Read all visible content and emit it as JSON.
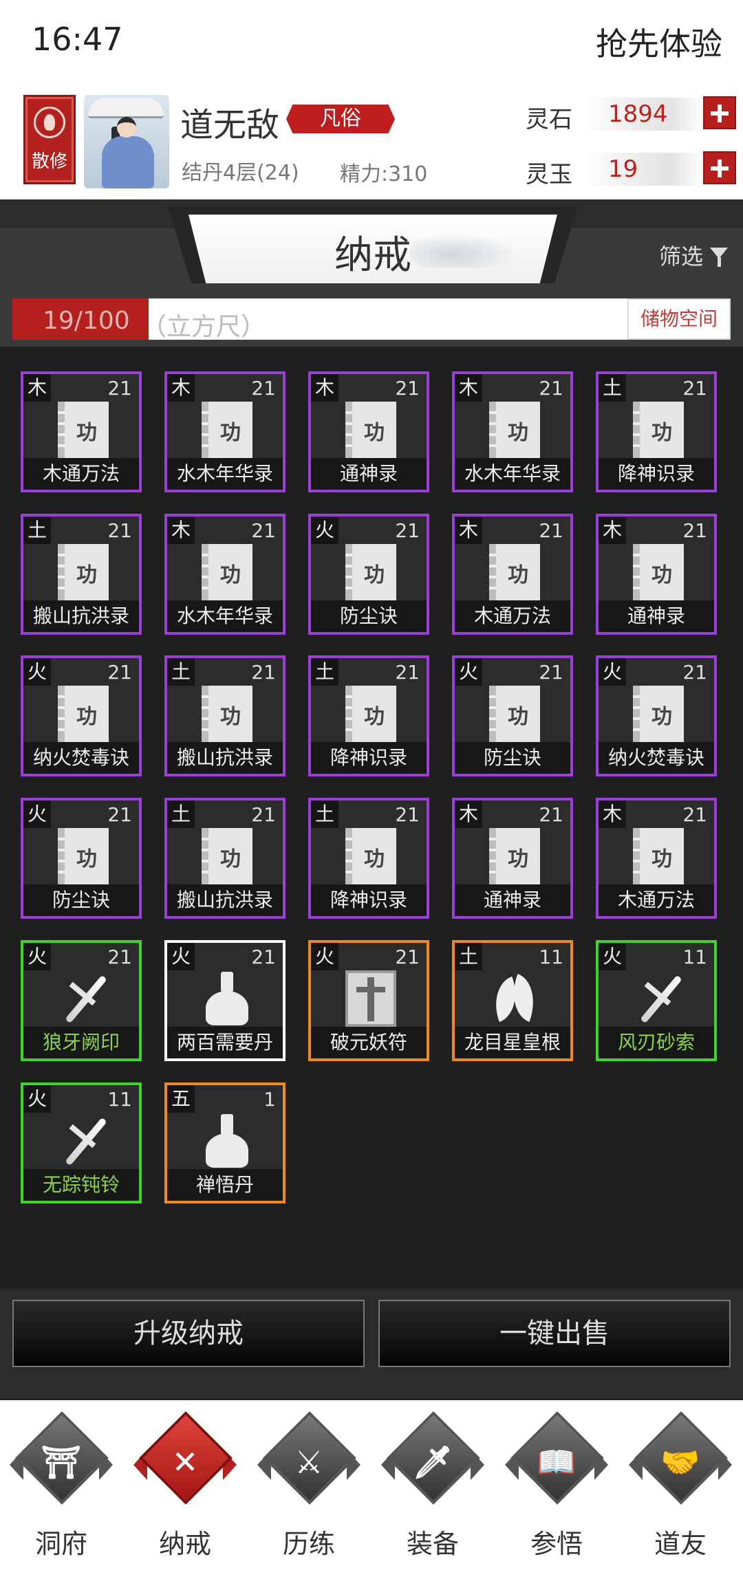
{
  "status": {
    "time": "16:47",
    "trial": "抢先体验"
  },
  "player": {
    "sect": "散修",
    "name": "道无敌",
    "realm_tag": "凡俗",
    "cultivation": "结丹4层(24)",
    "energy": "精力:310"
  },
  "resources": [
    {
      "label": "灵石",
      "value": "1894"
    },
    {
      "label": "灵玉",
      "value": "19"
    }
  ],
  "storage": {
    "title": "纳戒",
    "filter": "筛选",
    "capacity": "19/100",
    "unit": "（立方尺）",
    "space_button": "储物空间",
    "capacity_fraction": 0.19
  },
  "items": [
    {
      "element": "木",
      "level": "21",
      "name": "木通万法",
      "icon": "book-icon",
      "rarity_color": "#9c3fd8"
    },
    {
      "element": "木",
      "level": "21",
      "name": "水木年华录",
      "icon": "book-icon",
      "rarity_color": "#9c3fd8"
    },
    {
      "element": "木",
      "level": "21",
      "name": "通神录",
      "icon": "book-icon",
      "rarity_color": "#9c3fd8"
    },
    {
      "element": "木",
      "level": "21",
      "name": "水木年华录",
      "icon": "book-icon",
      "rarity_color": "#9c3fd8"
    },
    {
      "element": "土",
      "level": "21",
      "name": "降神识录",
      "icon": "book-icon",
      "rarity_color": "#9c3fd8"
    },
    {
      "element": "土",
      "level": "21",
      "name": "搬山抗洪录",
      "icon": "book-icon",
      "rarity_color": "#9c3fd8"
    },
    {
      "element": "木",
      "level": "21",
      "name": "水木年华录",
      "icon": "book-icon",
      "rarity_color": "#9c3fd8"
    },
    {
      "element": "火",
      "level": "21",
      "name": "防尘诀",
      "icon": "book-icon",
      "rarity_color": "#9c3fd8"
    },
    {
      "element": "木",
      "level": "21",
      "name": "木通万法",
      "icon": "book-icon",
      "rarity_color": "#9c3fd8"
    },
    {
      "element": "木",
      "level": "21",
      "name": "通神录",
      "icon": "book-icon",
      "rarity_color": "#9c3fd8"
    },
    {
      "element": "火",
      "level": "21",
      "name": "纳火焚毒诀",
      "icon": "book-icon",
      "rarity_color": "#9c3fd8"
    },
    {
      "element": "土",
      "level": "21",
      "name": "搬山抗洪录",
      "icon": "book-icon",
      "rarity_color": "#9c3fd8"
    },
    {
      "element": "土",
      "level": "21",
      "name": "降神识录",
      "icon": "book-icon",
      "rarity_color": "#9c3fd8"
    },
    {
      "element": "火",
      "level": "21",
      "name": "防尘诀",
      "icon": "book-icon",
      "rarity_color": "#9c3fd8"
    },
    {
      "element": "火",
      "level": "21",
      "name": "纳火焚毒诀",
      "icon": "book-icon",
      "rarity_color": "#9c3fd8"
    },
    {
      "element": "火",
      "level": "21",
      "name": "防尘诀",
      "icon": "book-icon",
      "rarity_color": "#9c3fd8"
    },
    {
      "element": "土",
      "level": "21",
      "name": "搬山抗洪录",
      "icon": "book-icon",
      "rarity_color": "#9c3fd8"
    },
    {
      "element": "土",
      "level": "21",
      "name": "降神识录",
      "icon": "book-icon",
      "rarity_color": "#9c3fd8"
    },
    {
      "element": "木",
      "level": "21",
      "name": "通神录",
      "icon": "book-icon",
      "rarity_color": "#9c3fd8"
    },
    {
      "element": "木",
      "level": "21",
      "name": "木通万法",
      "icon": "book-icon",
      "rarity_color": "#9c3fd8"
    },
    {
      "element": "火",
      "level": "21",
      "name": "狼牙阙印",
      "icon": "dagger-icon",
      "rarity_color": "#3fd42a"
    },
    {
      "element": "火",
      "level": "21",
      "name": "两百需要丹",
      "icon": "flask-icon",
      "rarity_color": "#ffffff"
    },
    {
      "element": "火",
      "level": "21",
      "name": "破元妖符",
      "icon": "talisman-icon",
      "rarity_color": "#f08a1c"
    },
    {
      "element": "土",
      "level": "11",
      "name": "龙目星皇根",
      "icon": "leaf-icon",
      "rarity_color": "#f08a1c"
    },
    {
      "element": "火",
      "level": "11",
      "name": "风刃砂索",
      "icon": "dagger-icon",
      "rarity_color": "#3fd42a"
    },
    {
      "element": "火",
      "level": "11",
      "name": "无踪钝铃",
      "icon": "dagger-icon",
      "rarity_color": "#3fd42a"
    },
    {
      "element": "五",
      "level": "1",
      "name": "禅悟丹",
      "icon": "flask-icon",
      "rarity_color": "#f08a1c"
    }
  ],
  "book_glyph": "功",
  "actions": {
    "upgrade": "升级纳戒",
    "sell_all": "一键出售"
  },
  "nav": [
    {
      "label": "洞府",
      "glyph": "⛩",
      "icon": "gate-icon",
      "active": false
    },
    {
      "label": "纳戒",
      "glyph": "✕",
      "icon": "ring-icon",
      "active": true
    },
    {
      "label": "历练",
      "glyph": "⚔",
      "icon": "crossed-swords-icon",
      "active": false
    },
    {
      "label": "装备",
      "glyph": "🗡",
      "icon": "dagger-icon",
      "active": false
    },
    {
      "label": "参悟",
      "glyph": "📖",
      "icon": "open-book-icon",
      "active": false
    },
    {
      "label": "道友",
      "glyph": "🤝",
      "icon": "handshake-icon",
      "active": false
    }
  ]
}
